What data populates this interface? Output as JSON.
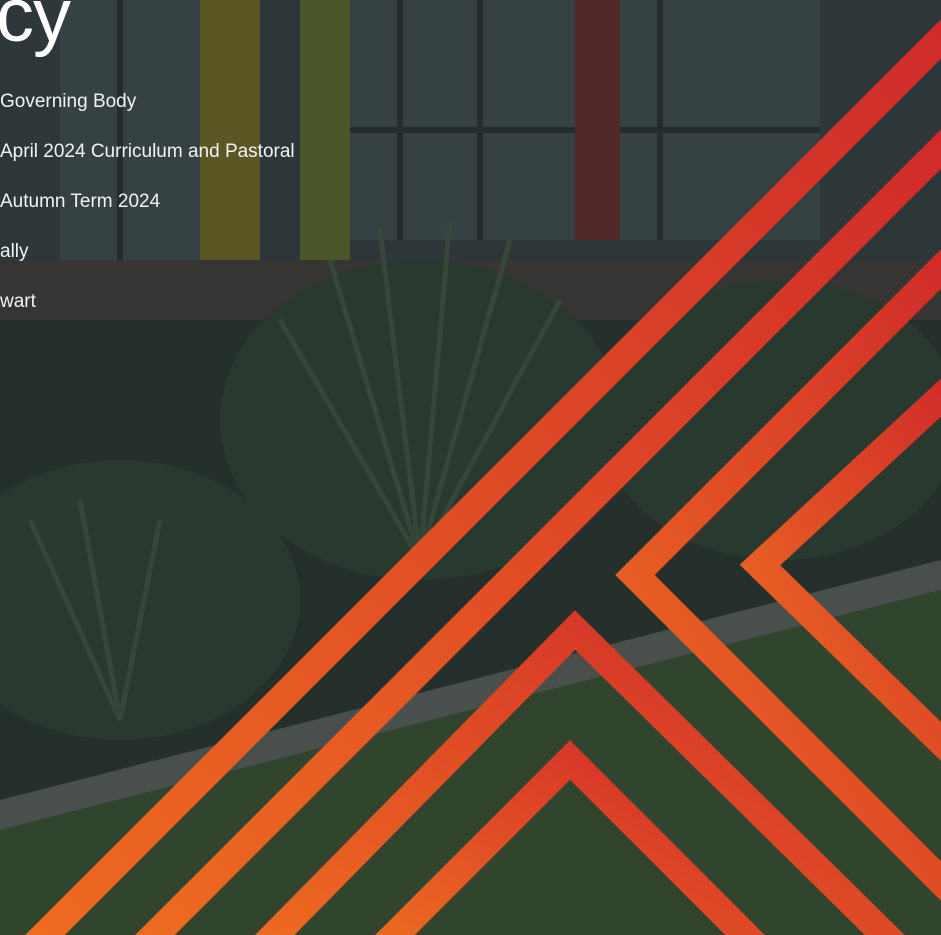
{
  "document": {
    "title_fragment": "cy",
    "details": [
      "Governing Body",
      "April 2024 Curriculum and Pastoral",
      "Autumn Term 2024",
      "ally",
      "wart"
    ]
  },
  "colors": {
    "stripe_top": "#cf2a2a",
    "stripe_bottom": "#ec6a1f",
    "overlay": "#1e2a30"
  }
}
